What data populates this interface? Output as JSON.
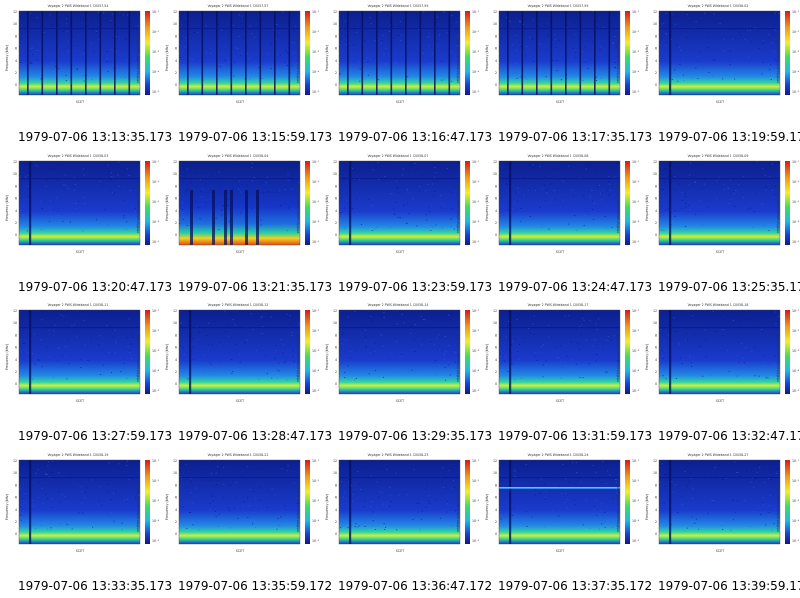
{
  "panels": [
    {
      "title": "Voyager 2 PWS Wideband 1 C0057-54",
      "caption": "1979-07-06 13:13:35.173",
      "variant": "pulsed"
    },
    {
      "title": "Voyager 2 PWS Wideband 1 C0057-57",
      "caption": "1979-07-06 13:15:59.173",
      "variant": "pulsed"
    },
    {
      "title": "Voyager 2 PWS Wideband 1 C0057-59",
      "caption": "1979-07-06 13:16:47.173",
      "variant": "pulsed"
    },
    {
      "title": "Voyager 2 PWS Wideband 1 C0057-59",
      "caption": "1979-07-06 13:17:35.173",
      "variant": "pulsed"
    },
    {
      "title": "Voyager 2 PWS Wideband 1 C0058-02",
      "caption": "1979-07-06 13:19:59.173",
      "variant": "spike"
    },
    {
      "title": "Voyager 2 PWS Wideband 1 C0058-03",
      "caption": "1979-07-06 13:20:47.173",
      "variant": "spike"
    },
    {
      "title": "Voyager 2 PWS Wideband 1 C0058-04",
      "caption": "1979-07-06 13:21:35.173",
      "variant": "noisy"
    },
    {
      "title": "Voyager 2 PWS Wideband 1 C0058-07",
      "caption": "1979-07-06 13:23:59.173",
      "variant": "spike"
    },
    {
      "title": "Voyager 2 PWS Wideband 1 C0058-08",
      "caption": "1979-07-06 13:24:47.173",
      "variant": "spike"
    },
    {
      "title": "Voyager 2 PWS Wideband 1 C0058-09",
      "caption": "1979-07-06 13:25:35.173",
      "variant": "spike"
    },
    {
      "title": "Voyager 2 PWS Wideband 1 C0058-11",
      "caption": "1979-07-06 13:27:59.173",
      "variant": "spike"
    },
    {
      "title": "Voyager 2 PWS Wideband 1 C0058-12",
      "caption": "1979-07-06 13:28:47.173",
      "variant": "spike"
    },
    {
      "title": "Voyager 2 PWS Wideband 1 C0058-14",
      "caption": "1979-07-06 13:29:35.173",
      "variant": "quiet"
    },
    {
      "title": "Voyager 2 PWS Wideband 1 C0058-17",
      "caption": "1979-07-06 13:31:59.173",
      "variant": "spike"
    },
    {
      "title": "Voyager 2 PWS Wideband 1 C0058-18",
      "caption": "1979-07-06 13:32:47.173",
      "variant": "spike"
    },
    {
      "title": "Voyager 2 PWS Wideband 1 C0058-19",
      "caption": "1979-07-06 13:33:35.173",
      "variant": "spike"
    },
    {
      "title": "Voyager 2 PWS Wideband 1 C0058-22",
      "caption": "1979-07-06 13:35:59.172",
      "variant": "quiet"
    },
    {
      "title": "Voyager 2 PWS Wideband 1 C0058-23",
      "caption": "1979-07-06 13:36:47.172",
      "variant": "spike"
    },
    {
      "title": "Voyager 2 PWS Wideband 1 C0058-24",
      "caption": "1979-07-06 13:37:35.172",
      "variant": "line"
    },
    {
      "title": "Voyager 2 PWS Wideband 1 C0058-27",
      "caption": "1979-07-06 13:39:59.172",
      "variant": "spike"
    }
  ],
  "plot_labels": {
    "ylabel": "Frequency (kHz)",
    "zlabel": "relative power spectral density",
    "yticks": [
      "12",
      "10",
      "8",
      "6",
      "4",
      "2",
      "0"
    ],
    "zticks": [
      "10⁻¹",
      "10⁻²",
      "10⁻³",
      "10⁻⁴",
      "10⁻⁵"
    ],
    "xfooter": "SCET"
  },
  "colors": {
    "background": "#ffffff",
    "caption_text": "#000000",
    "spectro_low": "#1a2fb0",
    "spectro_band": "#2fd58a",
    "spectro_hot": "#f2e82a"
  }
}
